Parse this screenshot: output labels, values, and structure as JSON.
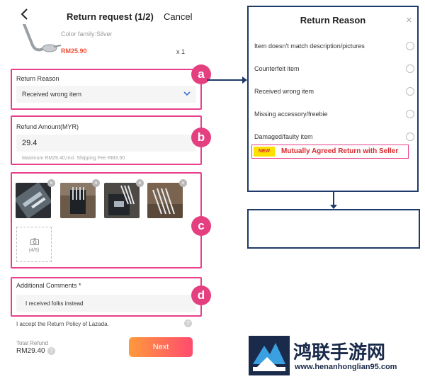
{
  "header": {
    "title": "Return request (1/2)",
    "cancel_label": "Cancel"
  },
  "product": {
    "color_family": "Color family:Silver",
    "price": "RM25.90",
    "qty": "x 1"
  },
  "return_reason": {
    "label": "Return Reason",
    "value": "Received wrong item"
  },
  "refund_amount": {
    "label": "Refund Amount(MYR)",
    "value": "29.4",
    "hint": "Maximum RM29.40,Incl. Shipping Fee RM3.50"
  },
  "photos": {
    "remove_glyph": "×",
    "upload_count": "(4/6)"
  },
  "comments": {
    "label": "Additional Comments *",
    "value": "I received folks instead"
  },
  "footer": {
    "policy": "I accept the Return Policy of Lazada.",
    "help_glyph": "?",
    "total_label": "Total Refund",
    "total_amount": "RM29.40",
    "next_label": "Next"
  },
  "badges": {
    "a": "a",
    "b": "b",
    "c": "c",
    "d": "d"
  },
  "popup": {
    "title": "Return Reason",
    "close_glyph": "×",
    "options": [
      "Item doesn't match description/pictures",
      "Counterfeit item",
      "Received wrong item",
      "Missing accessory/freebie",
      "Damaged/faulty item"
    ],
    "new_badge": "NEW",
    "new_option": "Mutually Agreed Return with Seller"
  },
  "watermark": {
    "title": "鸿联手游网",
    "url": "www.henanhonglian95.com"
  },
  "colors": {
    "highlight": "#e83e8c",
    "badge": "#e4407f",
    "navy": "#1f3a6a",
    "price": "#f0523a",
    "new_text": "#d8282e",
    "new_badge_bg": "#ffe100"
  },
  "icons": [
    "back-arrow-icon",
    "chevron-down-icon",
    "camera-icon",
    "close-icon",
    "help-icon",
    "radio-icon"
  ]
}
